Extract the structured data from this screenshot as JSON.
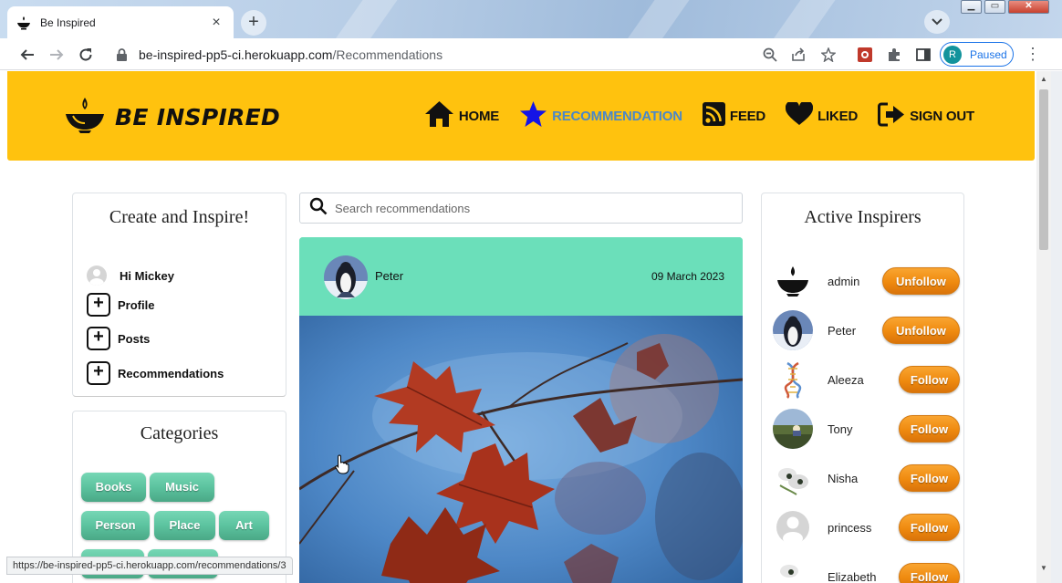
{
  "browser": {
    "tab_title": "Be Inspired",
    "tab_close": "×",
    "new_tab": "+",
    "url_host": "be-inspired-pp5-ci.herokuapp.com",
    "url_path": "/Recommendations",
    "profile_initial": "R",
    "profile_status": "Paused",
    "menu": "⋮",
    "status_url": "https://be-inspired-pp5-ci.herokuapp.com/recommendations/3"
  },
  "site": {
    "brand": "BE INSPIRED",
    "nav": [
      {
        "label": "HOME",
        "icon": "home-icon",
        "active": false
      },
      {
        "label": "RECOMMENDATION",
        "icon": "star-icon",
        "active": true
      },
      {
        "label": "FEED",
        "icon": "rss-icon",
        "active": false
      },
      {
        "label": "LIKED",
        "icon": "heart-icon",
        "active": false
      },
      {
        "label": "SIGN OUT",
        "icon": "sign-out-icon",
        "active": false
      }
    ],
    "colors": {
      "navbar": "#ffc20e",
      "active_link": "#4a87c9",
      "post_header": "#6bdfba",
      "chip": "#5cc39f",
      "follow_button": "#ef8a0f"
    }
  },
  "create": {
    "title": "Create and Inspire!",
    "greeting": "Hi Mickey",
    "links": [
      "Profile",
      "Posts",
      "Recommendations"
    ]
  },
  "categories": {
    "title": "Categories",
    "chips": [
      "Books",
      "Music",
      "Person",
      "Place",
      "Art"
    ]
  },
  "search": {
    "placeholder": "Search recommendations"
  },
  "post": {
    "author": "Peter",
    "date": "09 March 2023"
  },
  "inspirers": {
    "title": "Active Inspirers",
    "list": [
      {
        "name": "admin",
        "action": "Unfollow"
      },
      {
        "name": "Peter",
        "action": "Unfollow"
      },
      {
        "name": "Aleeza",
        "action": "Follow"
      },
      {
        "name": "Tony",
        "action": "Follow"
      },
      {
        "name": "Nisha",
        "action": "Follow"
      },
      {
        "name": "princess",
        "action": "Follow"
      },
      {
        "name": "Elizabeth",
        "action": "Follow"
      }
    ]
  }
}
